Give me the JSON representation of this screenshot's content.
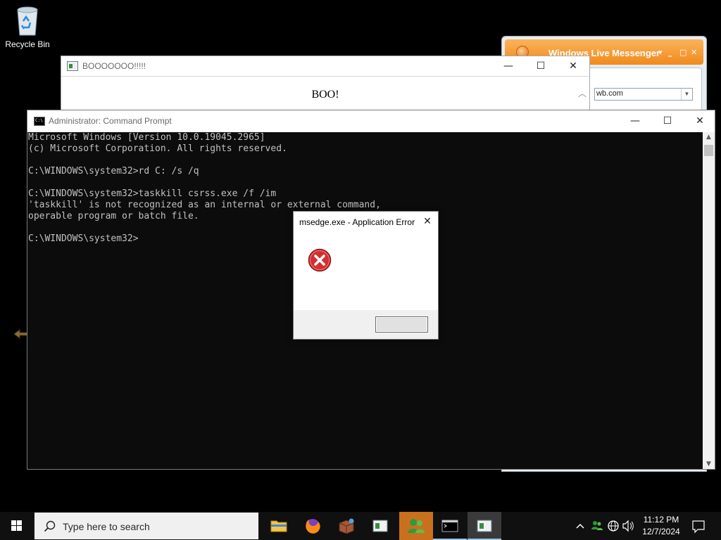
{
  "desktop": {
    "icons": [
      {
        "label": "Recycle Bin",
        "icon": "recycle-bin-icon"
      }
    ]
  },
  "messenger": {
    "title": "Windows Live Messenger",
    "address_value": "wb.com"
  },
  "boo_window": {
    "title": "BOOOOOOO!!!!!",
    "message": "BOO!",
    "controls": {
      "minimize": "—",
      "maximize": "☐",
      "close": "✕"
    }
  },
  "cmd_window": {
    "title": "Administrator: Command Prompt",
    "controls": {
      "minimize": "—",
      "maximize": "☐",
      "close": "✕"
    },
    "lines": [
      "Microsoft Windows [Version 10.0.19045.2965]",
      "(c) Microsoft Corporation. All rights reserved.",
      "",
      "C:\\WINDOWS\\system32>rd C: /s /q",
      "",
      "C:\\WINDOWS\\system32>taskkill csrss.exe /f /im",
      "'taskkill' is not recognized as an internal or external command,",
      "operable program or batch file.",
      "",
      "C:\\WINDOWS\\system32>"
    ]
  },
  "error_dialog": {
    "title": "msedge.exe - Application Error",
    "close_glyph": "✕",
    "message": "",
    "button_label": "",
    "colors": {
      "icon_red": "#d32f2f"
    }
  },
  "taskbar": {
    "search_placeholder": "Type here to search",
    "apps": [
      {
        "name": "file-explorer"
      },
      {
        "name": "firefox"
      },
      {
        "name": "package-app"
      },
      {
        "name": "boo-window-app"
      },
      {
        "name": "messenger-app",
        "state": "highlight"
      },
      {
        "name": "command-prompt-app"
      },
      {
        "name": "app-window",
        "state": "active"
      }
    ],
    "clock": {
      "time": "11:12 PM",
      "date": "12/7/2024"
    },
    "colors": {
      "background": "#101010",
      "highlight": "#c9701f"
    }
  }
}
